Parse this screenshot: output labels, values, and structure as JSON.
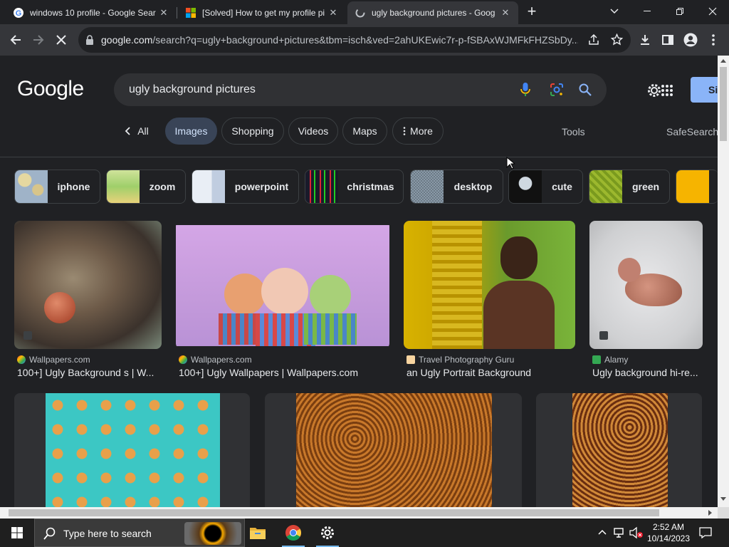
{
  "browser": {
    "tabs": [
      {
        "title": "windows 10 profile - Google Sear",
        "active": false
      },
      {
        "title": "[Solved] How to get my profile pi",
        "active": false
      },
      {
        "title": "ugly background pictures - Goog",
        "active": true
      }
    ],
    "url_host": "google.com",
    "url_path": "/search?q=ugly+background+pictures&tbm=isch&ved=2ahUKEwic7r-p-fSBAxWJMFkFHZSbDy..."
  },
  "search": {
    "logo": "Google",
    "query": "ugly background pictures",
    "signin_label": "Si"
  },
  "nav": {
    "all": "All",
    "images": "Images",
    "shopping": "Shopping",
    "videos": "Videos",
    "maps": "Maps",
    "more": "More",
    "tools": "Tools",
    "safesearch": "SafeSearch"
  },
  "chips": [
    "iphone",
    "zoom",
    "powerpoint",
    "christmas",
    "desktop",
    "cute",
    "green"
  ],
  "results": [
    {
      "source": "Wallpapers.com",
      "title": "100+] Ugly Background s | W..."
    },
    {
      "source": "Wallpapers.com",
      "title": "100+] Ugly Wallpapers | Wallpapers.com"
    },
    {
      "source": "Travel Photography Guru",
      "title": "an Ugly Portrait Background"
    },
    {
      "source": "Alamy",
      "title": "Ugly background hi-re..."
    }
  ],
  "taskbar": {
    "search_placeholder": "Type here to search",
    "time": "2:52 AM",
    "date": "10/14/2023"
  },
  "colors": {
    "page_bg": "#202124",
    "active_tab_bg": "#394457",
    "link_blue": "#8ab4f8"
  }
}
